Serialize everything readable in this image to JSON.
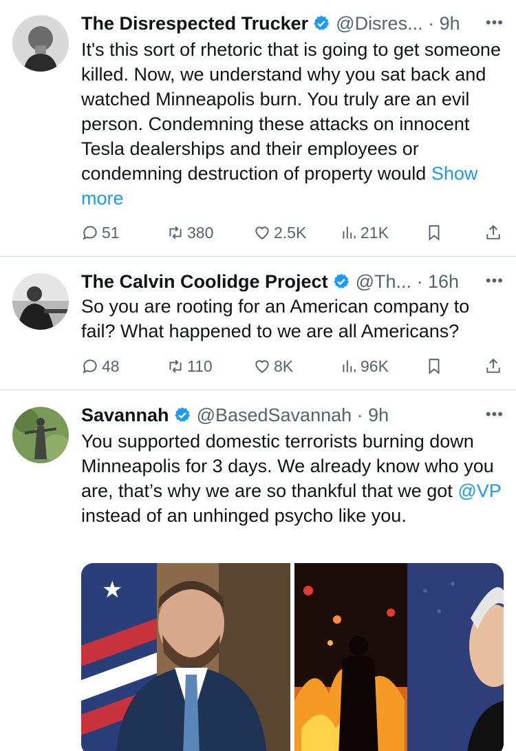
{
  "tweets": [
    {
      "name": "The Disrespected Trucker",
      "handle": "@Disres... · 9h",
      "text": "It's this sort of rhetoric that is going to get someone killed. Now, we understand why you sat back and watched Minneapolis burn. You truly are an evil person. Condemning these attacks on innocent Tesla dealerships and their employees or condemning destruction of property would",
      "show_more": "Show more",
      "replies": "51",
      "reposts": "380",
      "likes": "2.5K",
      "views": "21K"
    },
    {
      "name": "The Calvin Coolidge Project",
      "handle": "@Th... · 16h",
      "text": "So you are rooting for an American company to fail? What happened to we are all Americans?",
      "replies": "48",
      "reposts": "110",
      "likes": "8K",
      "views": "96K"
    },
    {
      "name": "Savannah",
      "handle": "@BasedSavannah · 9h",
      "text_before": "You supported domestic terrorists burning down Minneapolis for 3 days. We already know who you are, that’s why we are so thankful that we got ",
      "mention": "@VP",
      "text_after": " instead of an unhinged psycho like you."
    }
  ],
  "icons": {
    "verified": "verified-badge-icon",
    "more": "more-options-icon",
    "reply": "reply-icon",
    "repost": "repost-icon",
    "like": "heart-icon",
    "views": "views-icon",
    "bookmark": "bookmark-icon",
    "share": "share-icon"
  },
  "colors": {
    "accent": "#1d9bf0",
    "secondary_text": "#536471",
    "separator": "#cfd9de"
  }
}
